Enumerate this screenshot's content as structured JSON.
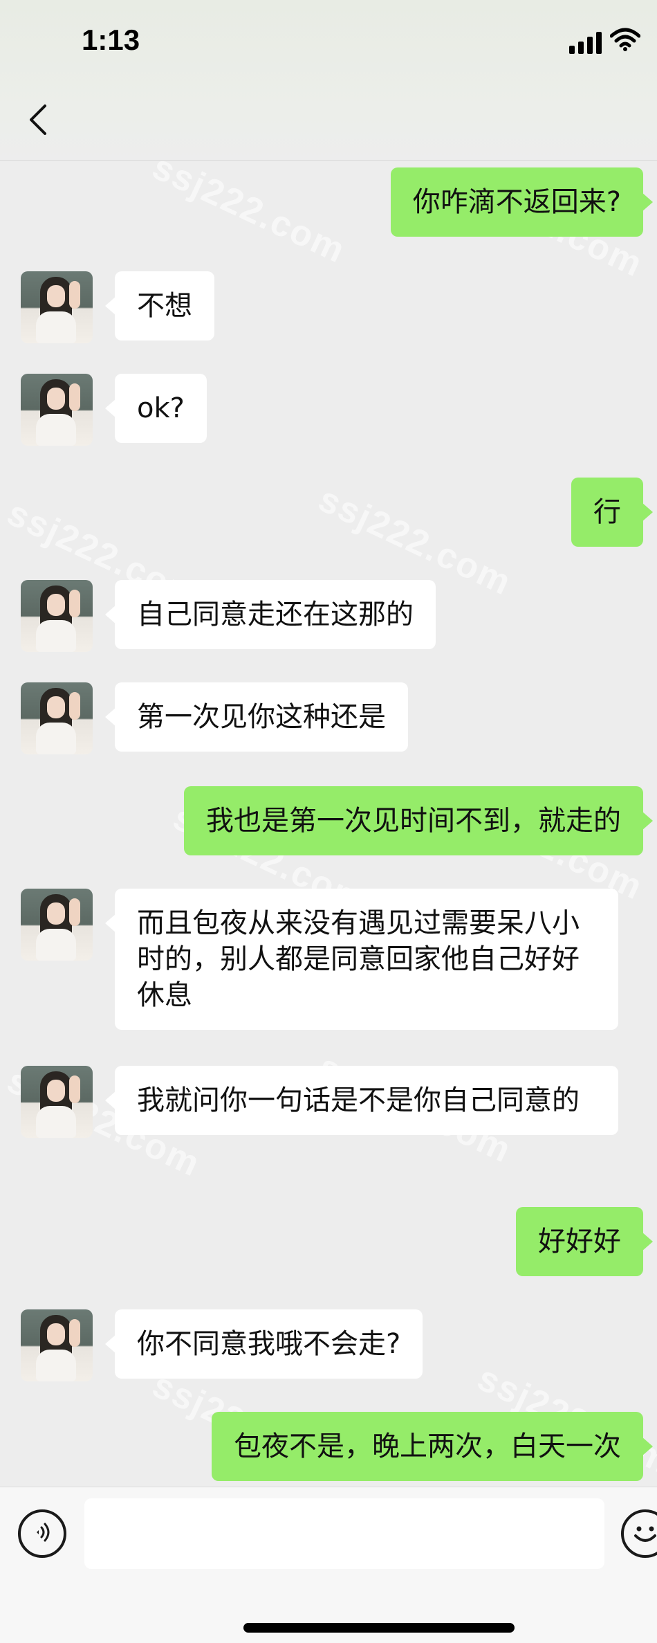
{
  "status_bar": {
    "time": "1:13"
  },
  "watermark_text": "ssj222.com",
  "messages": [
    {
      "side": "right",
      "text": "你咋滴不返回来?"
    },
    {
      "side": "left",
      "text": "不想"
    },
    {
      "side": "left",
      "text": "ok?"
    },
    {
      "side": "right",
      "text": "行"
    },
    {
      "side": "left",
      "text": "自己同意走还在这那的"
    },
    {
      "side": "left",
      "text": "第一次见你这种还是"
    },
    {
      "side": "right",
      "text": "我也是第一次见时间不到，就走的"
    },
    {
      "side": "left",
      "text": "而且包夜从来没有遇见过需要呆八小时的，别人都是同意回家他自己好好休息"
    },
    {
      "side": "left",
      "text": "我就问你一句话是不是你自己同意的"
    },
    {
      "side": "right",
      "text": "好好好"
    },
    {
      "side": "left",
      "text": "你不同意我哦不会走?"
    },
    {
      "side": "right",
      "text": "包夜不是，晚上两次，白天一次"
    }
  ],
  "input": {
    "value": ""
  },
  "icons": {
    "back": "chevron-left-icon",
    "voice": "voice-icon",
    "emoji": "emoji-icon",
    "signal": "signal-icon",
    "wifi": "wifi-icon"
  },
  "colors": {
    "bubble_self": "#95ec69",
    "bubble_other": "#ffffff",
    "background": "#ededed"
  }
}
